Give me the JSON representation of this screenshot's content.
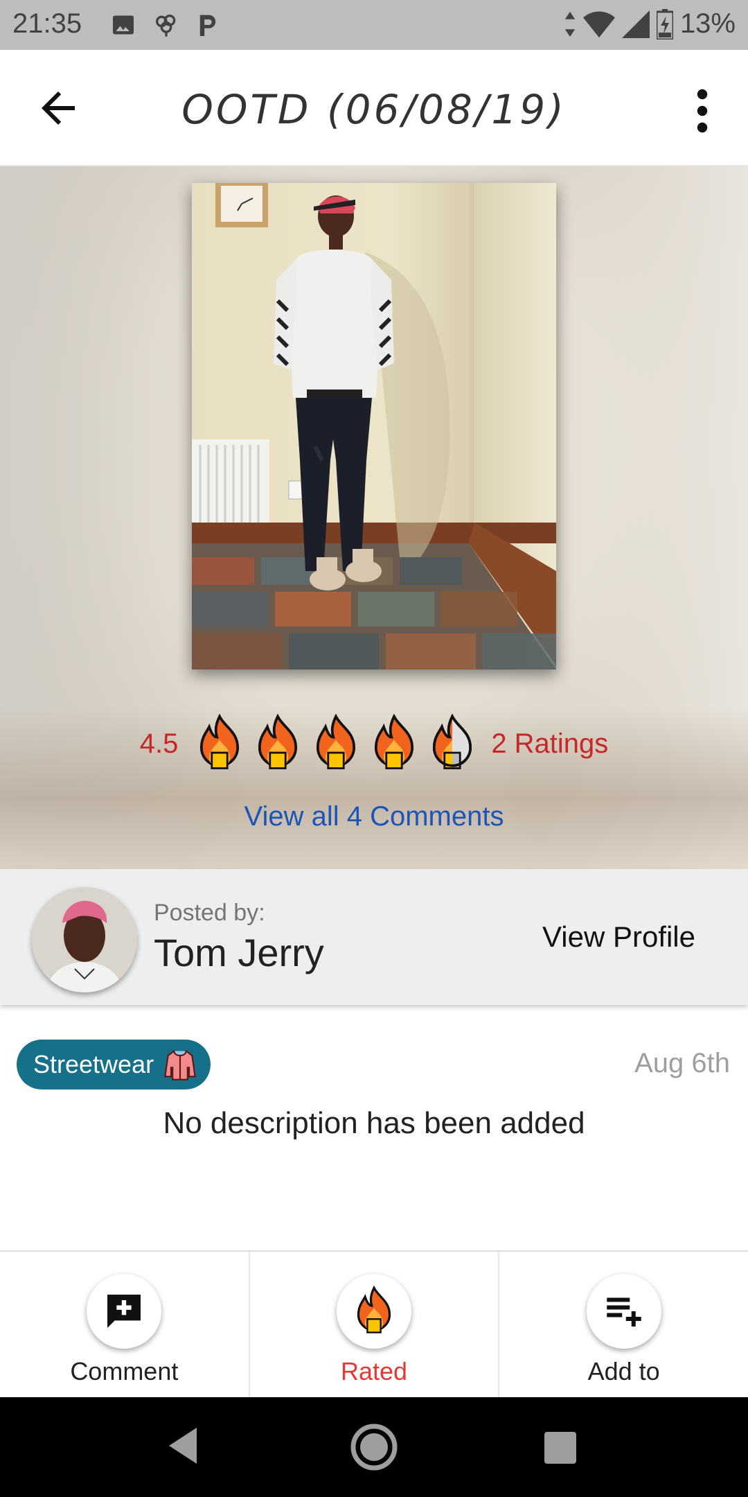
{
  "status_bar": {
    "time": "21:35",
    "battery": "13%",
    "left_icons": [
      "image-icon",
      "brain-icon",
      "parking-icon"
    ],
    "right_icons": [
      "data-arrows-icon",
      "wifi-icon",
      "signal-icon",
      "battery-charging-icon"
    ]
  },
  "app_bar": {
    "title": "OOTD (06/08/19)",
    "back_icon": "arrow-back-icon",
    "menu_icon": "more-vert-icon"
  },
  "post": {
    "rating_value": "4.5",
    "flames_filled_fraction": 0.9,
    "rating_count": "2 Ratings",
    "view_comments": "View all 4 Comments"
  },
  "poster": {
    "label": "Posted by:",
    "name": "Tom Jerry",
    "view_profile": "View Profile"
  },
  "details": {
    "category": "Streetwear",
    "category_icon": "jacket-icon",
    "date": "Aug 6th",
    "description": "No description has been added"
  },
  "actions": [
    {
      "label": "Comment",
      "icon": "add-comment-icon",
      "active": false
    },
    {
      "label": "Rated",
      "icon": "flame-icon",
      "active": true
    },
    {
      "label": "Add to",
      "icon": "playlist-add-icon",
      "active": false
    }
  ],
  "colors": {
    "accent_red": "#c62828",
    "link_blue": "#1a56b8",
    "chip_teal": "#16708a",
    "active_red": "#e53935"
  }
}
